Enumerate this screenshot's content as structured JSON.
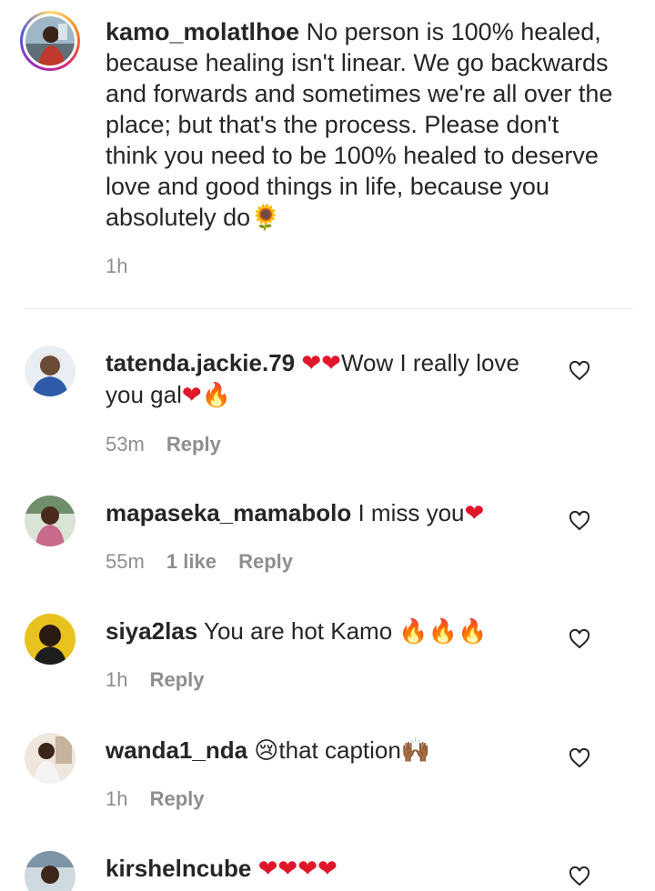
{
  "caption": {
    "username": "kamo_molatlhoe",
    "text": "No person is 100% healed, because healing isn't linear. We go backwards and forwards and sometimes we're all over the place; but that's the process. Please don't think you need to be 100% healed to deserve love and good things in life, because you absolutely do",
    "emoji": "🌻",
    "time": "1h"
  },
  "comments": [
    {
      "username": "tatenda.jackie.79",
      "pre_emoji": "❤❤",
      "text_a": "Wow I really love you gal",
      "post_emoji_a": "❤",
      "post_emoji_b": "🔥",
      "time": "53m",
      "likes": "",
      "reply": "Reply"
    },
    {
      "username": "mapaseka_mamabolo",
      "text_a": "I miss you",
      "post_emoji_a": "❤",
      "time": "55m",
      "likes": "1 like",
      "reply": "Reply"
    },
    {
      "username": "siya2las",
      "text_a": "You are hot Kamo ",
      "post_emoji_b": "🔥🔥🔥",
      "time": "1h",
      "reply": "Reply"
    },
    {
      "username": "wanda1_nda",
      "pre_emoji": "😢",
      "text_a": "that caption",
      "post_emoji_b": "🙌🏾",
      "time": "1h",
      "reply": "Reply"
    },
    {
      "username": "kirshelncube",
      "post_emoji_a": "❤❤❤❤",
      "time": "",
      "reply": ""
    }
  ],
  "colors": {
    "text": "#262626",
    "meta": "#8e8e8e",
    "heart_emoji": "#e0162b",
    "fire_emoji": "#f2691b",
    "divider": "#e6e6e6"
  }
}
